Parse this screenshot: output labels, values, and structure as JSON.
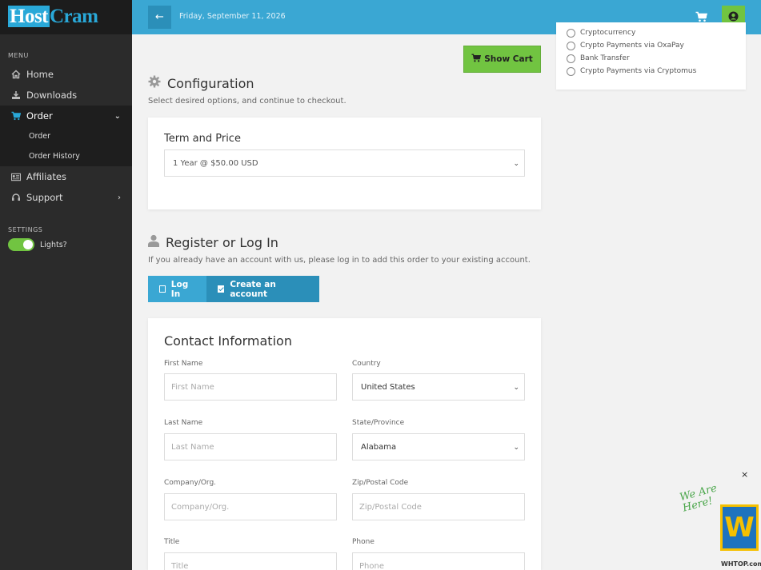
{
  "brand": {
    "host": "Host",
    "cram": "Cram"
  },
  "topbar": {
    "date": "Friday, September 11, 2026"
  },
  "sidebar": {
    "menu_label": "MENU",
    "items": [
      {
        "label": "Home",
        "icon": "home-icon"
      },
      {
        "label": "Downloads",
        "icon": "download-icon"
      },
      {
        "label": "Order",
        "icon": "cart-icon"
      },
      {
        "label": "Affiliates",
        "icon": "affiliates-icon"
      },
      {
        "label": "Support",
        "icon": "support-icon"
      }
    ],
    "order_sub": [
      "Order",
      "Order History"
    ],
    "settings_label": "SETTINGS",
    "lights_label": "Lights?"
  },
  "cart": {
    "show_cart": "Show Cart"
  },
  "payment": {
    "options": [
      "Cryptocurrency",
      "Crypto Payments via OxaPay",
      "Bank Transfer",
      "Crypto Payments via Cryptomus"
    ]
  },
  "configuration": {
    "title": "Configuration",
    "subtitle": "Select desired options, and continue to checkout.",
    "term_title": "Term and Price",
    "term_value": "1 Year @ $50.00 USD"
  },
  "register": {
    "title": "Register or Log In",
    "subtitle": "If you already have an account with us, please log in to add this order to your existing account.",
    "login": "Log In",
    "create": "Create an account"
  },
  "contact": {
    "title": "Contact Information",
    "first_name_label": "First Name",
    "first_name_ph": "First Name",
    "country_label": "Country",
    "country_value": "United States",
    "last_name_label": "Last Name",
    "last_name_ph": "Last Name",
    "state_label": "State/Province",
    "state_value": "Alabama",
    "company_label": "Company/Org.",
    "company_ph": "Company/Org.",
    "zip_label": "Zip/Postal Code",
    "zip_ph": "Zip/Postal Code",
    "title_label": "Title",
    "title_ph": "Title",
    "phone_label": "Phone",
    "phone_ph": "Phone"
  },
  "widget": {
    "tagline_1": "We Are",
    "tagline_2": "Here!",
    "logo": "W",
    "site": "WHTOP.com",
    "close": "×"
  }
}
